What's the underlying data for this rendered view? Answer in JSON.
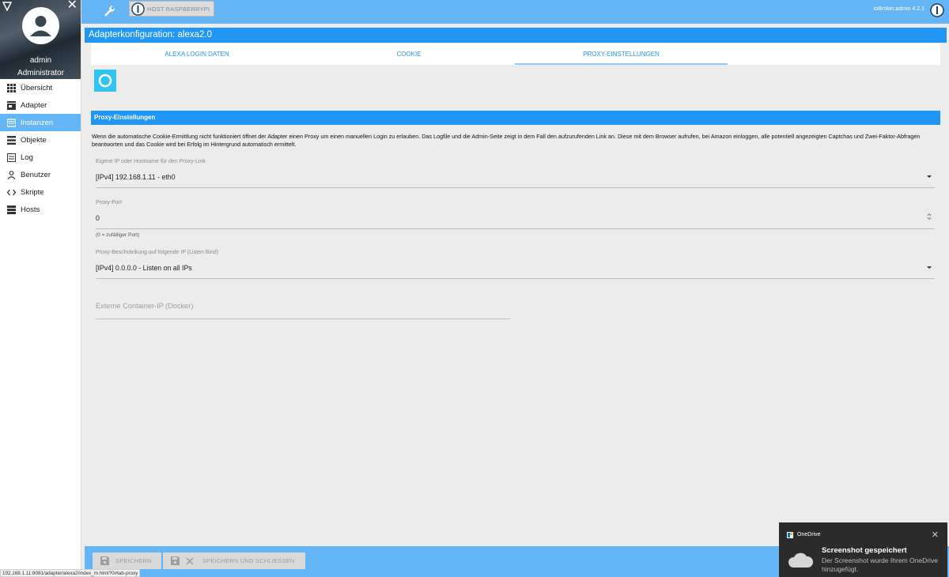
{
  "sidebar": {
    "user_name": "admin",
    "user_role": "Administrator",
    "items": [
      {
        "label": "Übersicht",
        "icon": "grid-icon"
      },
      {
        "label": "Adapter",
        "icon": "store-icon"
      },
      {
        "label": "Instanzen",
        "icon": "instances-icon",
        "active": true
      },
      {
        "label": "Objekte",
        "icon": "list-icon"
      },
      {
        "label": "Log",
        "icon": "log-icon"
      },
      {
        "label": "Benutzer",
        "icon": "user-icon"
      },
      {
        "label": "Skripte",
        "icon": "code-icon"
      },
      {
        "label": "Hosts",
        "icon": "hosts-icon"
      }
    ]
  },
  "topbar": {
    "host_label": "HOST RASPBERRYPI",
    "version": "ioBroker.admin 4.2.1"
  },
  "main": {
    "title": "Adapterkonfiguration: alexa2.0",
    "tabs": [
      {
        "label": "ALEXA LOGIN DATEN"
      },
      {
        "label": "COOKIE"
      },
      {
        "label": "PROXY-EINSTELLUNGEN",
        "active": true
      }
    ],
    "section_title": "Proxy-Einstellungen",
    "description": "Wenn die automatische Cookie-Ermittlung nicht funktioniert öffnet der Adapter einen Proxy um einen manuellen Login zu erlauben. Das Logfile und die Admin-Seite zeigt in dem Fall den aufzurufenden Link an. Diese mit dem Browser aufrufen, bei Amazon einloggen, alle potentiell angezeigten Captchas und Zwei-Faktor-Abfragen beantworten und das Cookie wird bei Erfolg im Hintergrund automatisch ermittelt.",
    "fields": {
      "own_ip": {
        "label": "Eigene IP oder Hostname für den Proxy-Link",
        "value": "[IPv4] 192.168.1.11 - eth0"
      },
      "proxy_port": {
        "label": "Proxy-Port",
        "value": "0",
        "helper": "(0 = zufälliger Port)"
      },
      "listen_bind": {
        "label": "Proxy-Beschränkung auf folgende IP (Listen Bind)",
        "value": "[IPv4] 0.0.0.0 - Listen on all IPs"
      },
      "docker_ip": {
        "placeholder": "Externe Container-IP (Docker)",
        "value": ""
      }
    }
  },
  "footer": {
    "save_label": "SPEICHERN",
    "save_close_label": "SPEICHERN UND SCHLIESSEN"
  },
  "statusbar": {
    "url": "192.168.1.11:8081/adapter/alexa2/index_m.html?0#tab-proxy"
  },
  "toast": {
    "app": "OneDrive",
    "title": "Screenshot gespeichert",
    "body": "Der Screenshot wurde Ihrem OneDrive hinzugefügt."
  },
  "colors": {
    "primary": "#2196f3",
    "light_primary": "#64b5f6",
    "alexa": "#31c4f3"
  }
}
